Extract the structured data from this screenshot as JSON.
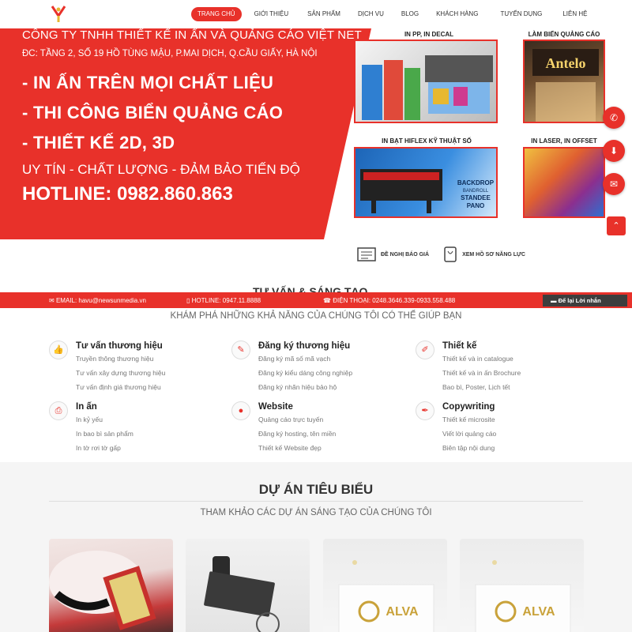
{
  "nav": {
    "items": [
      {
        "label": "Trang chủ",
        "active": true
      },
      {
        "label": "Giới thiệu"
      },
      {
        "label": "Sản phẩm"
      },
      {
        "label": "Dịch vụ"
      },
      {
        "label": "Blog"
      },
      {
        "label": "Khách hàng"
      },
      {
        "label": "Tuyển dụng"
      },
      {
        "label": "Liên hệ"
      }
    ]
  },
  "hero": {
    "company": "CÔNG TY TNHH THIẾT KẾ IN ẤN VÀ QUẢNG CÁO VIỆT NET",
    "address": "ĐC: TẦNG 2, SỐ 19 HỒ TÙNG MẬU, P.MAI DỊCH, Q.CẦU GIẤY, HÀ NỘI",
    "bullets": [
      "- IN ẤN TRÊN MỌI CHẤT LIỆU",
      "- THI CÔNG BIỂN QUẢNG CÁO",
      "- THIẾT KẾ 2D, 3D"
    ],
    "slogan": "UY TÍN - CHẤT LƯỢNG - ĐẢM BẢO TIẾN ĐỘ",
    "hotline": "HOTLINE: 0982.860.863",
    "panels": [
      {
        "title": "IN PP, IN DECAL"
      },
      {
        "title": "LÀM BIỂN QUẢNG CÁO",
        "sign_text": "Antelo"
      },
      {
        "title": "IN BẠT HIFLEX KỸ THUẬT SỐ",
        "banner_lines": [
          "BACKDROP",
          "BANDROLL",
          "STANDEE",
          "PANO"
        ]
      },
      {
        "title": "IN LASER, IN OFFSET"
      }
    ]
  },
  "quote_links": {
    "request_quote": "ĐỀ NGHỊ BÁO GIÁ",
    "view_profile": "XEM HỒ SƠ NĂNG LỰC"
  },
  "contact_bar": {
    "email": "EMAIL: havu@newsunmedia.vn",
    "hotline": "HOTLINE: 0947.11.8888",
    "phone": "ĐIỆN THOẠI: 0248.3646.339-0933.558.488",
    "leave_message": "Để lại Lời nhắn"
  },
  "services": {
    "heading": "TƯ VẤN & SÁNG TẠO",
    "subtitle": "KHÁM PHÁ NHỮNG KHẢ NĂNG CỦA CHÚNG TÔI CÓ THỂ GIÚP BẠN",
    "groups": [
      {
        "title": "Tư vấn thương hiệu",
        "icon": "thumbs-up-icon",
        "items": [
          "Truyền thông thương hiệu",
          "Tư vấn xây dựng thương hiệu",
          "Tư vấn định giá thương hiệu"
        ]
      },
      {
        "title": "Đăng ký thương hiệu",
        "icon": "pencil-icon",
        "items": [
          "Đăng ký mã số mã vạch",
          "Đăng ký kiểu dáng công nghiệp",
          "Đăng ký nhãn hiệu bảo hộ"
        ]
      },
      {
        "title": "Thiết kế",
        "icon": "edit-icon",
        "items": [
          "Thiết kế và in catalogue",
          "Thiết kế và in ấn Brochure",
          "Bao bì, Poster, Lịch tết"
        ]
      },
      {
        "title": "In ấn",
        "icon": "printer-icon",
        "items": [
          "In kỷ yếu",
          "In bao bì sản phẩm",
          "In tờ rơi tờ gấp"
        ]
      },
      {
        "title": "Website",
        "icon": "globe-icon",
        "items": [
          "Quảng cáo trực tuyến",
          "Đăng ký hosting, tên miền",
          "Thiết kế Website đẹp"
        ]
      },
      {
        "title": "Copywriting",
        "icon": "pen-icon",
        "items": [
          "Thiết kế microsite",
          "Viết lời quảng cáo",
          "Biên tập nội dung"
        ]
      }
    ]
  },
  "projects": {
    "title": "DỰ ÁN TIÊU BIỂU",
    "subtitle": "THAM KHẢO CÁC DỰ ÁN SÁNG TẠO CỦA CHÚNG TÔI",
    "cards": [
      {
        "image": "book-photo"
      },
      {
        "image": "stamp-photo"
      },
      {
        "image": "alva-card-photo",
        "brand": "ALVA"
      },
      {
        "image": "alva-card-photo",
        "brand": "ALVA"
      }
    ]
  },
  "float_buttons": [
    "phone-icon",
    "download-icon",
    "mail-icon"
  ],
  "colors": {
    "accent": "#e8312a",
    "dark": "#3d3d3d"
  }
}
